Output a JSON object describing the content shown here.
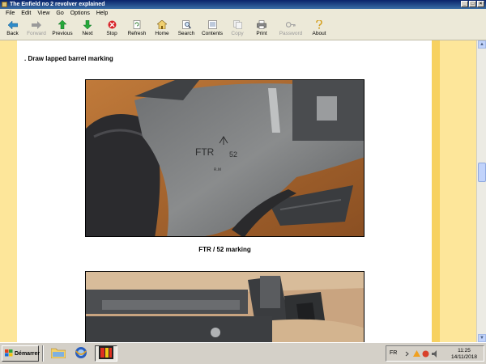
{
  "window": {
    "title": "The Enfield no 2 revolver explained"
  },
  "menu": [
    "File",
    "Edit",
    "View",
    "Go",
    "Options",
    "Help"
  ],
  "toolbar": [
    {
      "label": "Back",
      "icon": "back-arrow-icon",
      "enabled": true
    },
    {
      "label": "Forward",
      "icon": "forward-arrow-icon",
      "enabled": false
    },
    {
      "label": "Previous",
      "icon": "up-arrow-icon",
      "enabled": true
    },
    {
      "label": "Next",
      "icon": "down-arrow-icon",
      "enabled": true
    },
    {
      "label": "Stop",
      "icon": "stop-icon",
      "enabled": true
    },
    {
      "label": "Refresh",
      "icon": "refresh-icon",
      "enabled": true
    },
    {
      "label": "Home",
      "icon": "home-icon",
      "enabled": true
    },
    {
      "label": "Search",
      "icon": "search-icon",
      "enabled": true
    },
    {
      "label": "Contents",
      "icon": "contents-icon",
      "enabled": true
    },
    {
      "label": "Copy",
      "icon": "copy-icon",
      "enabled": false
    },
    {
      "label": "Print",
      "icon": "print-icon",
      "enabled": true
    },
    {
      "label": "Password",
      "icon": "key-icon",
      "enabled": false
    },
    {
      "label": "About",
      "icon": "about-icon",
      "enabled": true
    }
  ],
  "content": {
    "heading": ". Draw lapped barrel marking",
    "caption": "FTR / 52 marking",
    "stamp": {
      "letters": "FTR",
      "number": "52"
    }
  },
  "taskbar": {
    "start_label": "Démarrer",
    "language": "FR",
    "time": "11:25",
    "date": "14/11/2018"
  },
  "colors": {
    "side_panel": "#fde69a",
    "accent_stripe": "#f7d160",
    "title_bar": "#0a246a"
  }
}
